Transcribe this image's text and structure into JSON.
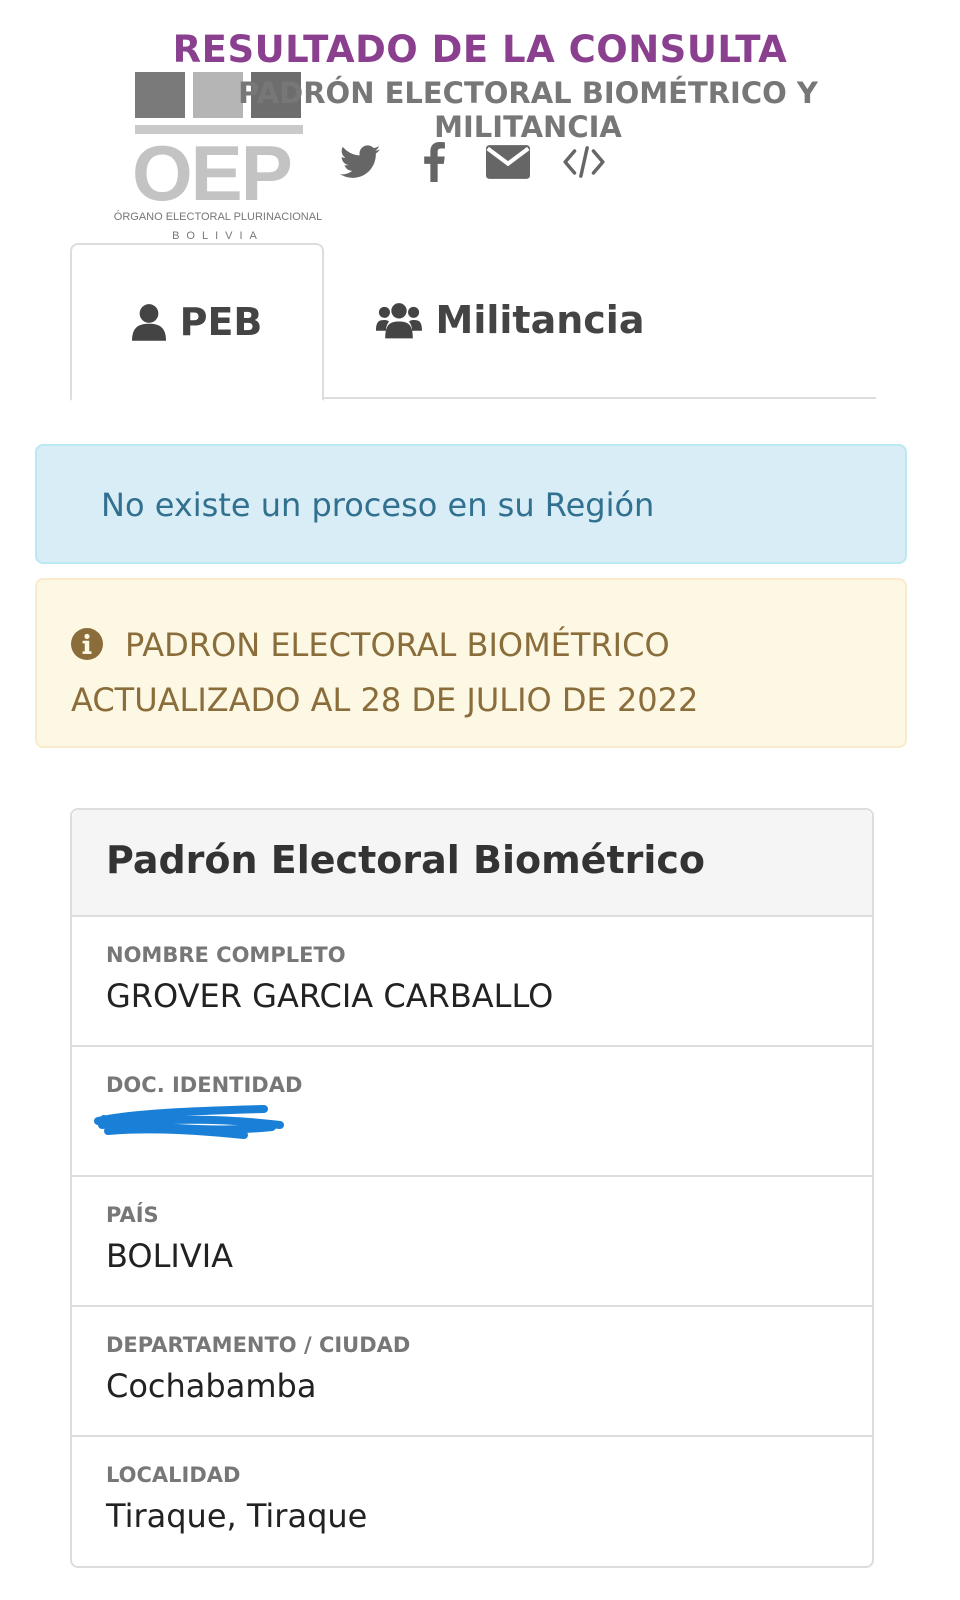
{
  "header": {
    "title": "RESULTADO DE LA CONSULTA",
    "subtitle": "PADRÓN ELECTORAL BIOMÉTRICO Y MILITANCIA"
  },
  "logo": {
    "text": "OEP",
    "org": "ÓRGANO ELECTORAL PLURINACIONAL",
    "country": "BOLIVIA",
    "colors": [
      "#9b4f99",
      "#e8c237",
      "#3b8f4b"
    ]
  },
  "social_icons": [
    "twitter-icon",
    "facebook-icon",
    "envelope-icon",
    "code-icon"
  ],
  "tabs": [
    {
      "label": "PEB",
      "icon": "user-icon",
      "active": true
    },
    {
      "label": "Militancia",
      "icon": "users-icon",
      "active": false
    }
  ],
  "alerts": {
    "info": "No existe un proceso en su Región",
    "warning": "PADRON ELECTORAL BIOMÉTRICO ACTUALIZADO AL 28 DE JULIO DE 2022"
  },
  "panel": {
    "title": "Padrón Electoral Biométrico",
    "fields": [
      {
        "label": "NOMBRE COMPLETO",
        "value": "GROVER GARCIA CARBALLO"
      },
      {
        "label": "DOC. IDENTIDAD",
        "value": ""
      },
      {
        "label": "PAÍS",
        "value": "BOLIVIA"
      },
      {
        "label": "DEPARTAMENTO / CIUDAD",
        "value": "Cochabamba"
      },
      {
        "label": "LOCALIDAD",
        "value": "Tiraque, Tiraque"
      }
    ]
  },
  "colors": {
    "title": "#8a3f8f",
    "info_bg": "#d9edf7",
    "info_text": "#31708f",
    "warning_bg": "#fcf8e3",
    "warning_text": "#8a6d3b",
    "redaction": "#1a7fd6"
  }
}
